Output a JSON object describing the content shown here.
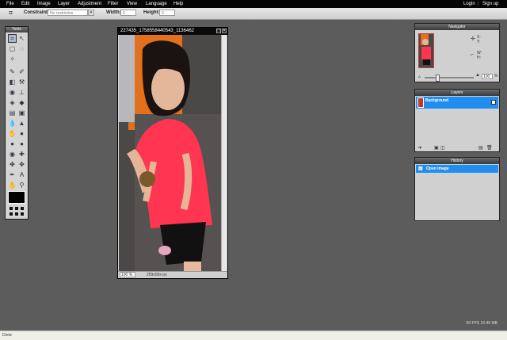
{
  "menu": {
    "items": [
      "File",
      "Edit",
      "Image",
      "Layer",
      "Adjustment",
      "Filter",
      "View",
      "Language",
      "Help"
    ],
    "login": "Login",
    "separator": "|",
    "signup": "Sign up"
  },
  "options": {
    "constraint_label": "Constraint:",
    "constraint_value": "No restriction",
    "width_label": "Width:",
    "width_value": "0",
    "height_label": "Height:",
    "height_value": "0"
  },
  "tools": {
    "title": "Tools"
  },
  "image_window": {
    "title": "227435_1758558440543_1136462",
    "zoom": "100 %",
    "size": "259x59x px"
  },
  "navigator": {
    "title": "Navigator",
    "x_label": "X:",
    "y_label": "Y:",
    "w_label": "W:",
    "h_label": "H:",
    "zoom_value": "100",
    "zoom_unit": "%"
  },
  "layers": {
    "title": "Layers",
    "items": [
      {
        "name": "Background",
        "selected": true
      }
    ]
  },
  "history": {
    "title": "History",
    "items": [
      {
        "name": "Open image",
        "selected": true
      }
    ]
  },
  "status_bar": {
    "text": "Done"
  },
  "fps": "59 FPS 22.46 MB",
  "colors": {
    "workspace": "#5c5c5c",
    "menubar": "#050505",
    "selection": "#1f8ef0",
    "panel": "#d0d0d0"
  }
}
